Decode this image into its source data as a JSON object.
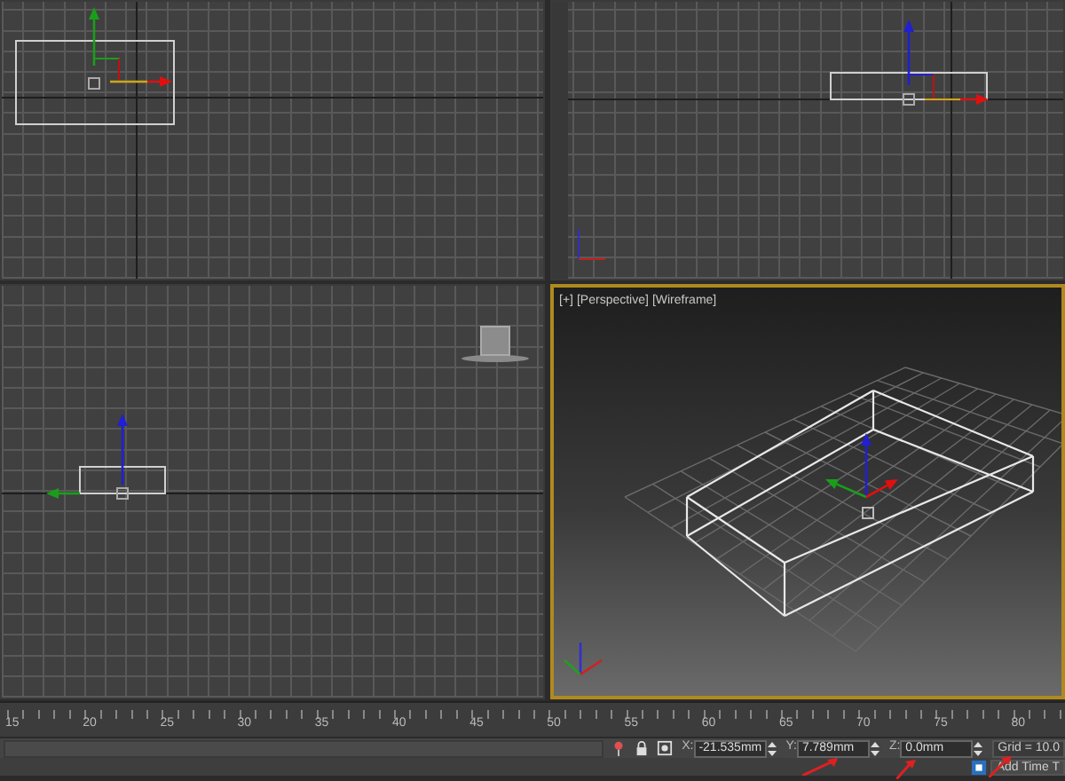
{
  "viewports": [
    {
      "kind": "top",
      "active": false
    },
    {
      "kind": "front",
      "active": false
    },
    {
      "kind": "left",
      "active": false
    },
    {
      "kind": "perspective",
      "active": true,
      "labels": [
        "[+]",
        "[Perspective]",
        "[Wireframe]"
      ]
    }
  ],
  "timeline": {
    "ticks": [
      "15",
      "20",
      "25",
      "30",
      "35",
      "40",
      "45",
      "50",
      "55",
      "60",
      "65",
      "70",
      "75",
      "80"
    ]
  },
  "status_bar": {
    "coords": [
      {
        "axis": "X:",
        "value": "-21.535mm"
      },
      {
        "axis": "Y:",
        "value": "7.789mm"
      },
      {
        "axis": "Z:",
        "value": "0.0mm"
      }
    ],
    "grid": "Grid = 10.0",
    "time_tag": "Add Time T"
  }
}
